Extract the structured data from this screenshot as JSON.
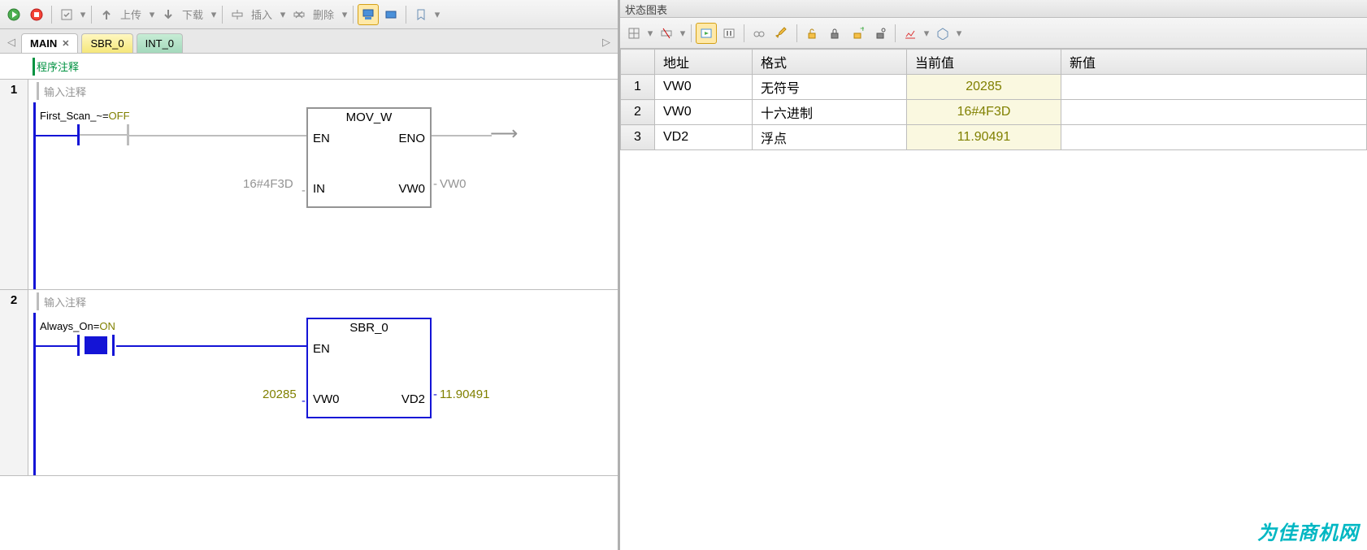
{
  "toolbar_left": {
    "upload": "上传",
    "download": "下载",
    "insert": "插入",
    "delete": "删除"
  },
  "tabs": {
    "main": "MAIN",
    "sbr": "SBR_0",
    "int": "INT_0"
  },
  "program_comment": "程序注释",
  "network1": {
    "num": "1",
    "comment": "输入注释",
    "contact_label": "First_Scan_~=",
    "contact_state": "OFF",
    "block_title": "MOV_W",
    "en": "EN",
    "eno": "ENO",
    "in": "IN",
    "out": "VW0",
    "in_val": "16#4F3D",
    "out_val": "VW0"
  },
  "network2": {
    "num": "2",
    "comment": "输入注释",
    "contact_label": "Always_On=",
    "contact_state": "ON",
    "block_title": "SBR_0",
    "en": "EN",
    "in_port": "VW0",
    "out_port": "VD2",
    "in_val": "20285",
    "out_val": "11.90491"
  },
  "right_panel": {
    "title": "状态图表",
    "headers": {
      "addr": "地址",
      "format": "格式",
      "current": "当前值",
      "new": "新值"
    },
    "rows": [
      {
        "num": "1",
        "addr": "VW0",
        "format": "无符号",
        "current": "20285",
        "new": ""
      },
      {
        "num": "2",
        "addr": "VW0",
        "format": "十六进制",
        "current": "16#4F3D",
        "new": ""
      },
      {
        "num": "3",
        "addr": "VD2",
        "format": "浮点",
        "current": "11.90491",
        "new": ""
      }
    ]
  },
  "watermark": "为佳商机网"
}
